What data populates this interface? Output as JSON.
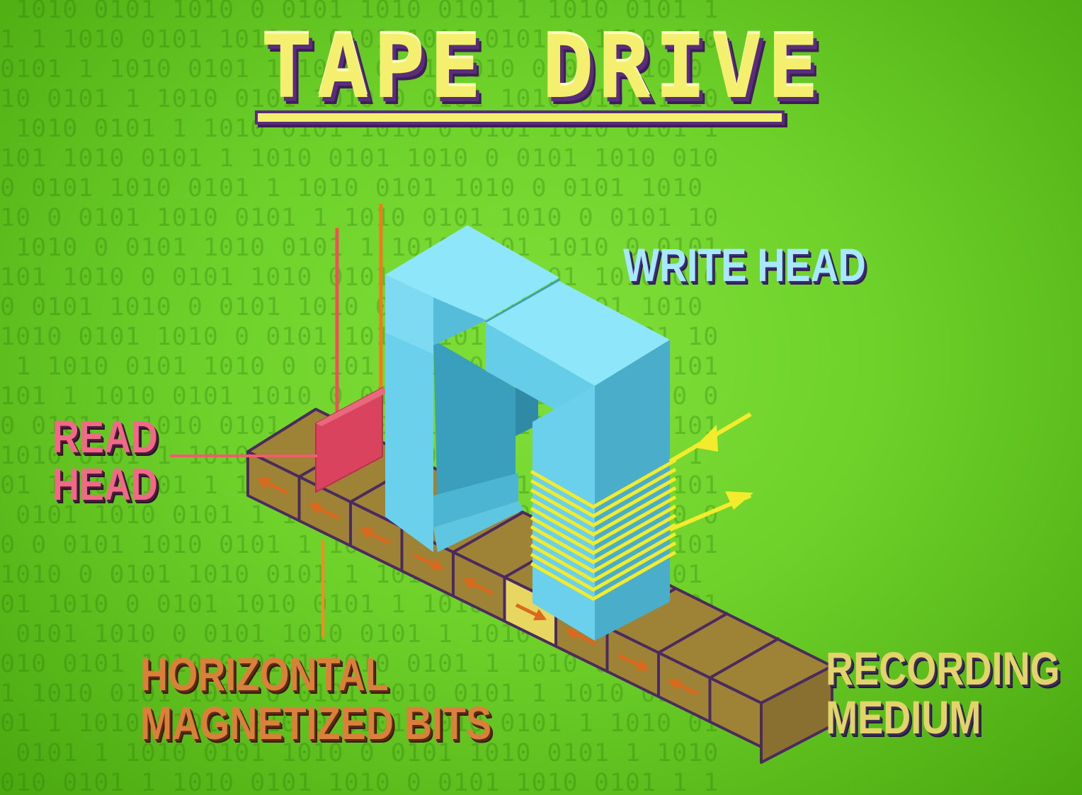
{
  "title": "TAPE DRIVE",
  "labels": {
    "write_head": "WRITE HEAD",
    "read_head": [
      "READ",
      "HEAD"
    ],
    "horizontal_bits": [
      "HORIZONTAL",
      "MAGNETIZED BITS"
    ],
    "recording_medium": [
      "RECORDING",
      "MEDIUM"
    ]
  },
  "background": {
    "pattern": "binary-digits",
    "color": "#6ed12a"
  },
  "tape": {
    "cell_count": 10,
    "highlighted_cell": 5,
    "bit_directions": [
      "left",
      "left",
      "left",
      "right",
      "left",
      "right",
      "left",
      "right",
      "left",
      "none"
    ]
  },
  "colors": {
    "title_fill": "#f4ef6e",
    "title_outline": "#5a2d7a",
    "write_head": "#7fd8f0",
    "read_head": "#d9435e",
    "tape_fill": "#9e8336",
    "tape_highlight": "#e7d760",
    "tape_outline": "#4b2a5e",
    "coil": "#f3ec2c",
    "bit_arrow": "#d9691c",
    "leader_read": "#ee5f6d",
    "leader_bits": "#f08d2a"
  }
}
